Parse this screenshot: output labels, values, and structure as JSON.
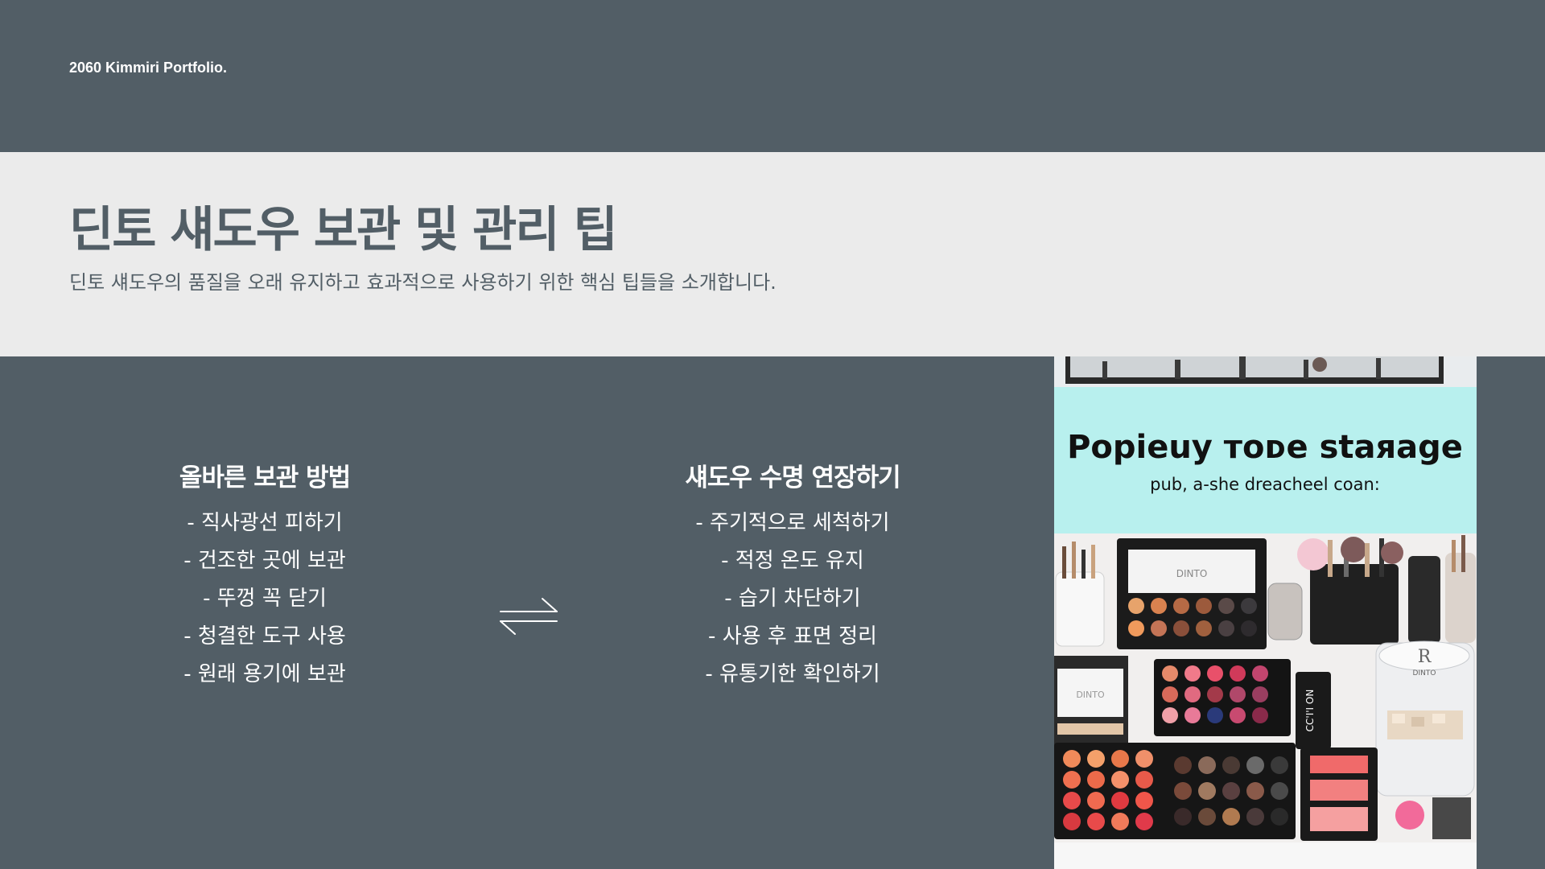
{
  "brand": "2060 Kimmiri Portfolio.",
  "header": {
    "title": "딘토 섀도우 보관 및 관리 팁",
    "subtitle": "딘토 섀도우의 품질을 오래 유지하고 효과적으로 사용하기 위한 핵심 팁들을 소개합니다."
  },
  "storage": {
    "heading": "올바른 보관 방법",
    "items": [
      "- 직사광선 피하기",
      "- 건조한 곳에 보관",
      "- 뚜껑 꼭 닫기",
      "- 청결한 도구 사용",
      "- 원래 용기에 보관"
    ]
  },
  "lifespan": {
    "heading": "섀도우 수명 연장하기",
    "items": [
      "- 주기적으로 세척하기",
      "- 적정 온도 유지",
      "- 습기 차단하기",
      "- 사용 후 표면 정리",
      "- 유통기한 확인하기"
    ]
  },
  "photo": {
    "banner_title": "Popieuy тоᴅe staяage",
    "banner_subtitle": "pub, a-she dreacheel coan:",
    "palette_label_1": "DINTO",
    "palette_label_2": "DINTO",
    "jar_label": "R",
    "jar_sub": "DINTO",
    "box_label": "CC'I'I ON"
  },
  "icons": {
    "swap": "swap-arrows-icon"
  },
  "colors": {
    "background": "#525e66",
    "header_band": "#ebebeb",
    "banner": "#b8f0ee"
  }
}
